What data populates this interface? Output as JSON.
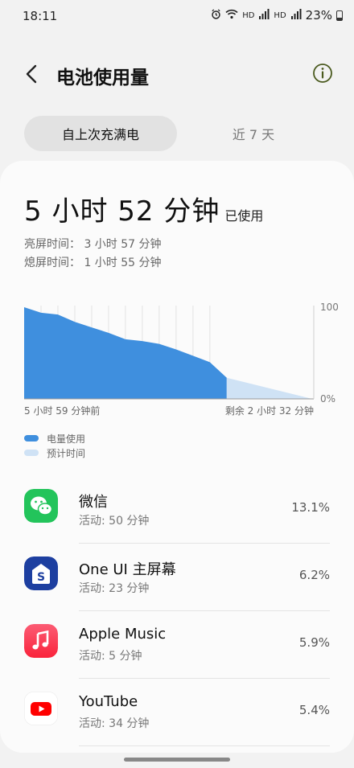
{
  "status": {
    "time": "18:11",
    "battery_pct": "23%",
    "hd1": "HD",
    "sig1": "5G",
    "hd2": "HD",
    "sig2": "5G"
  },
  "header": {
    "title": "电池使用量"
  },
  "tabs": [
    {
      "label": "自上次充满电"
    },
    {
      "label": "近 7 天"
    }
  ],
  "usage": {
    "total": "5 小时 52 分钟",
    "total_suffix": "已使用",
    "screen_on": "亮屏时间：  3 小时 57 分钟",
    "screen_off": "熄屏时间：  1 小时 55 分钟"
  },
  "chart": {
    "y_max_label": "100",
    "y_min_label": "0%",
    "x_start_label": "5 小时 59 分钟前",
    "x_end_label": "剩余 2 小时 32 分钟",
    "legend_used": "电量使用",
    "legend_predicted": "预计时间",
    "used_color": "#3f8fde",
    "predicted_color": "#cfe2f5"
  },
  "chart_data": {
    "type": "area",
    "ylim": [
      0,
      100
    ],
    "series": [
      {
        "name": "电量使用",
        "x": [
          0,
          0.5,
          1,
          1.5,
          2,
          2.5,
          3,
          3.5,
          4,
          4.5,
          5,
          5.5,
          6
        ],
        "values": [
          100,
          94,
          92,
          84,
          78,
          72,
          65,
          63,
          60,
          54,
          47,
          40,
          23
        ]
      },
      {
        "name": "预计时间",
        "x": [
          6,
          8.53
        ],
        "values": [
          23,
          0
        ]
      }
    ]
  },
  "apps": [
    {
      "name": "微信",
      "activity": "活动: 50 分钟",
      "pct": "13.1%",
      "icon": "wechat-icon"
    },
    {
      "name": "One UI 主屏幕",
      "activity": "活动: 23 分钟",
      "pct": "6.2%",
      "icon": "oneui-home-icon"
    },
    {
      "name": "Apple Music",
      "activity": "活动: 5 分钟",
      "pct": "5.9%",
      "icon": "apple-music-icon"
    },
    {
      "name": "YouTube",
      "activity": "活动: 34 分钟",
      "pct": "5.4%",
      "icon": "youtube-icon"
    }
  ]
}
